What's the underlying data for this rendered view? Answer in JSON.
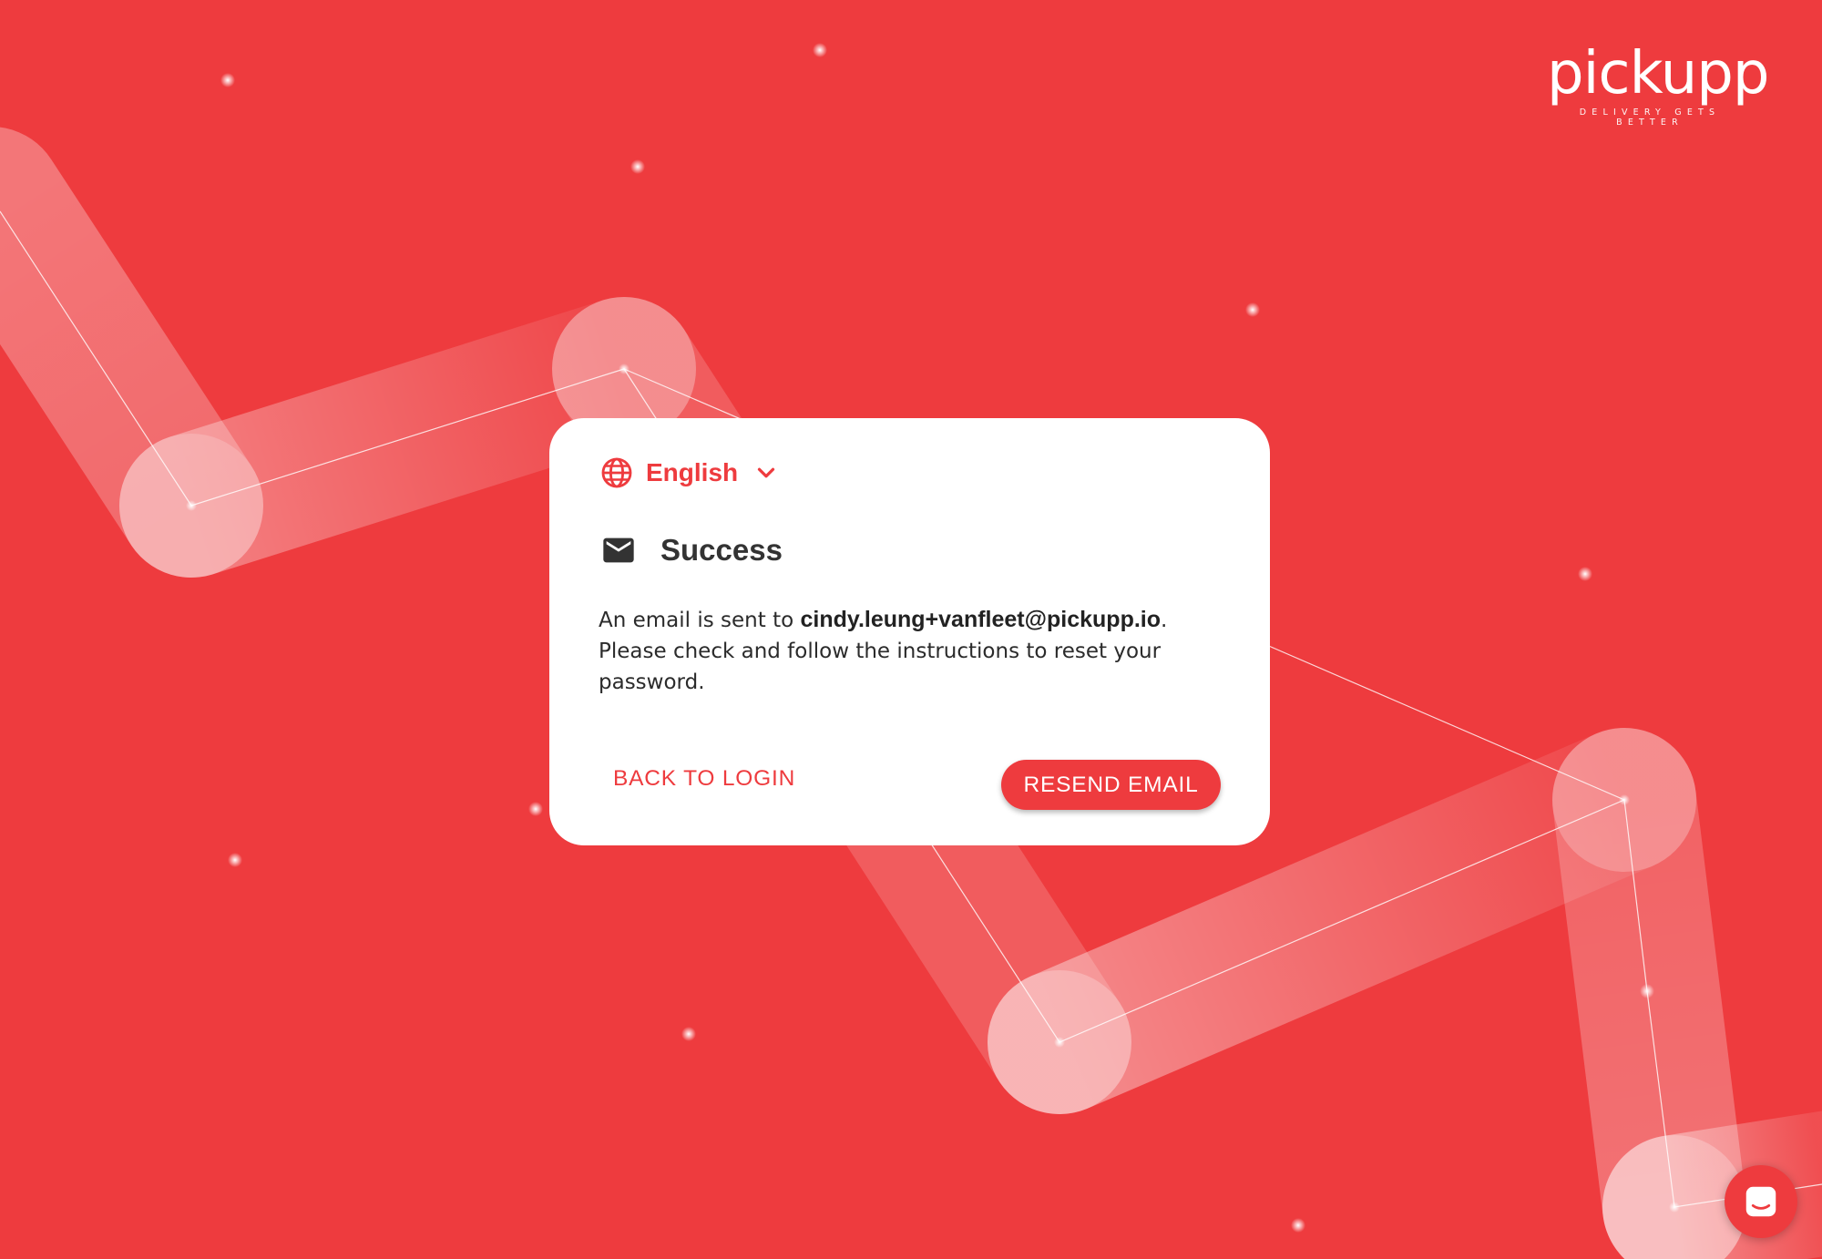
{
  "brand": {
    "name": "pickupp",
    "tagline": "DELIVERY GETS BETTER",
    "primary_color": "#ee3b3e"
  },
  "language": {
    "selected": "English",
    "icon": "globe-icon",
    "dropdown_icon": "chevron-down-icon"
  },
  "dialog": {
    "icon": "mail-icon",
    "title": "Success",
    "message_prefix": "An email is sent to ",
    "email": "cindy.leung+vanfleet@pickupp.io",
    "message_suffix": ".",
    "message_line2": "Please check and follow the instructions to reset your password.",
    "back_label": "BACK TO LOGIN",
    "resend_label": "RESEND EMAIL"
  },
  "chat": {
    "icon": "chat-icon"
  }
}
